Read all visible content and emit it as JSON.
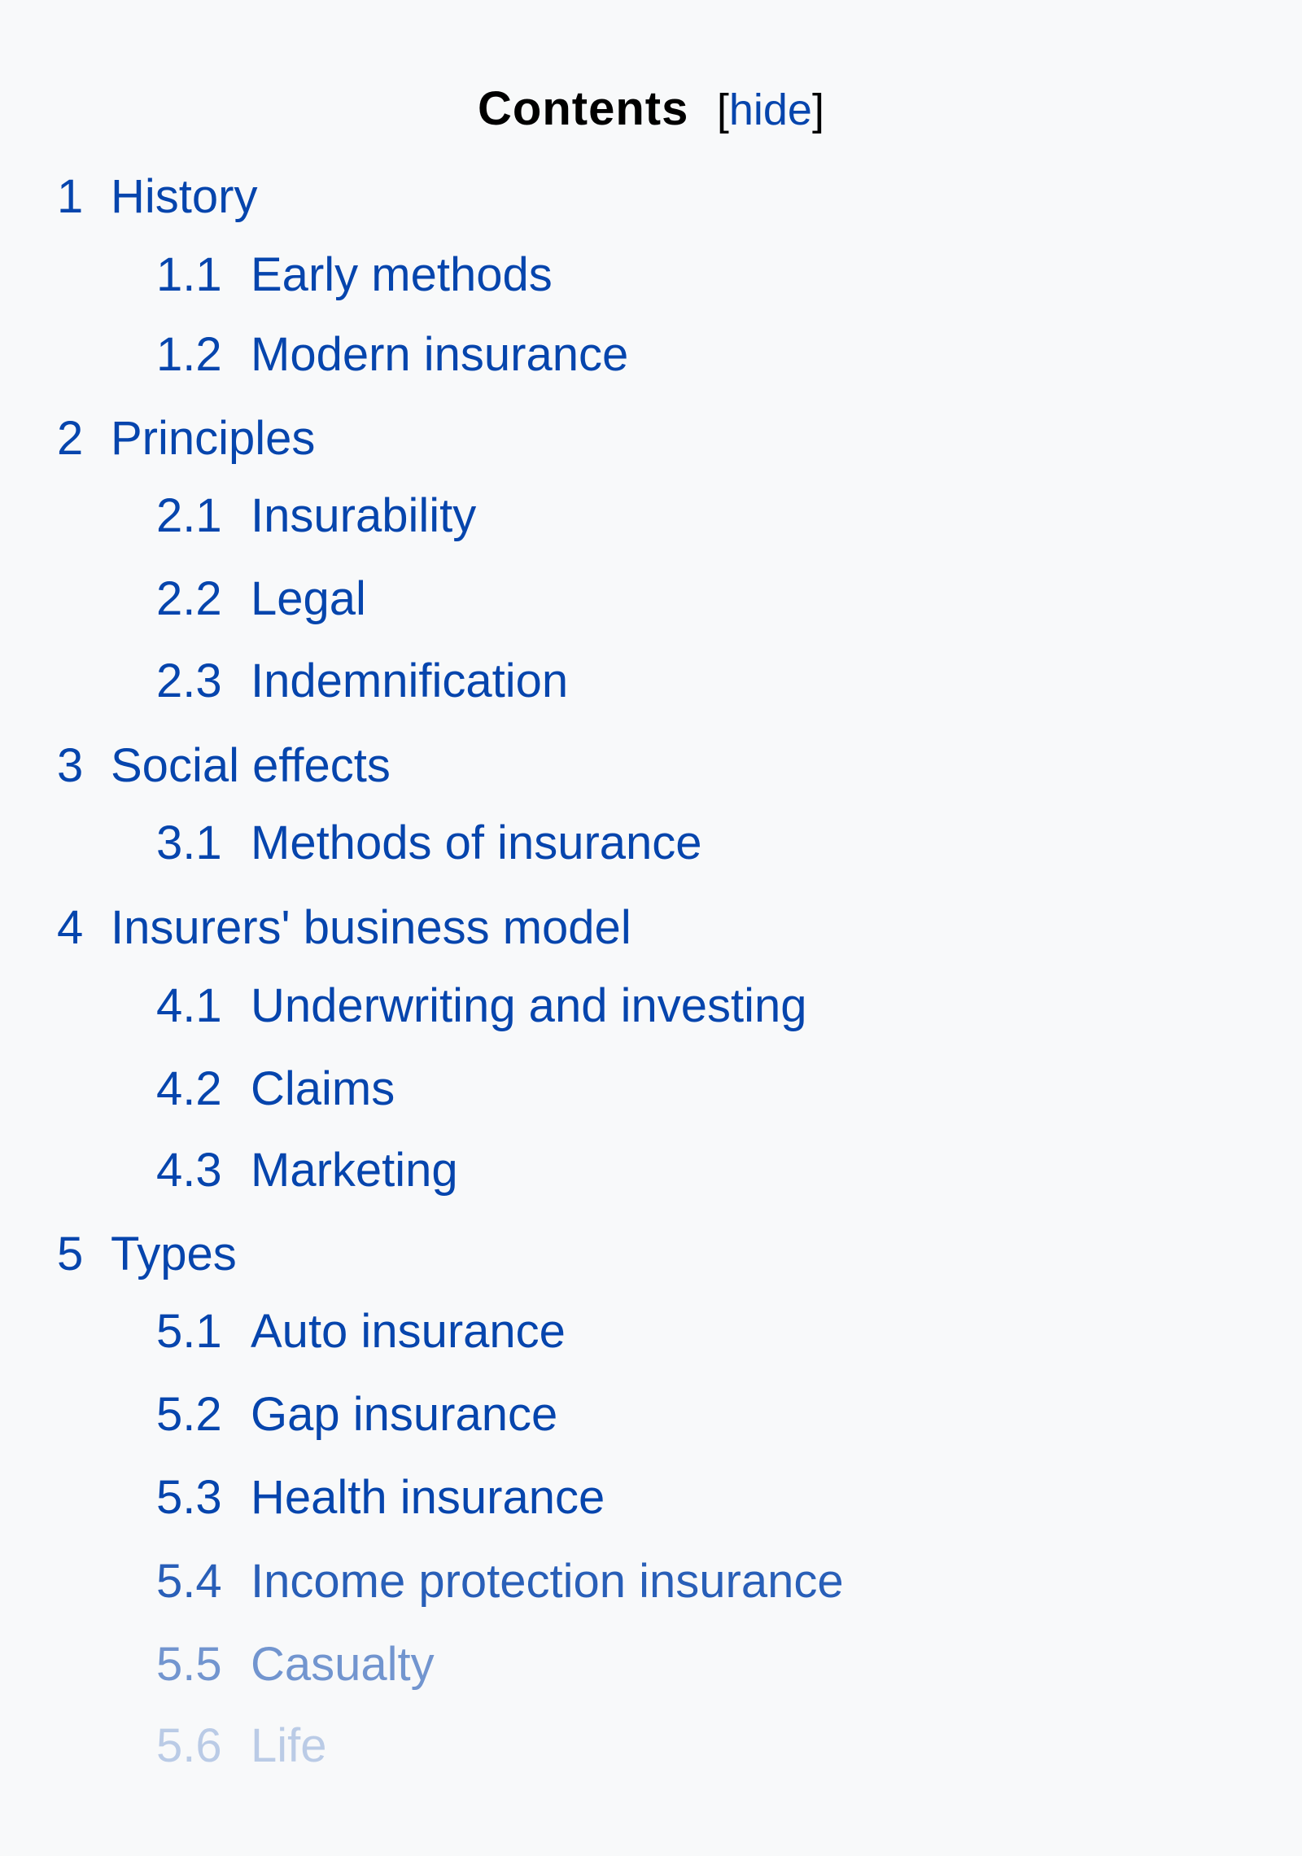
{
  "toc": {
    "title": "Contents",
    "toggle_open": "[",
    "toggle_label": "hide",
    "toggle_close": "]",
    "items": [
      {
        "number": "1",
        "label": "History",
        "level": 1
      },
      {
        "number": "1.1",
        "label": "Early methods",
        "level": 2
      },
      {
        "number": "1.2",
        "label": "Modern insurance",
        "level": 2
      },
      {
        "number": "2",
        "label": "Principles",
        "level": 1
      },
      {
        "number": "2.1",
        "label": "Insurability",
        "level": 2
      },
      {
        "number": "2.2",
        "label": "Legal",
        "level": 2
      },
      {
        "number": "2.3",
        "label": "Indemnification",
        "level": 2
      },
      {
        "number": "3",
        "label": "Social effects",
        "level": 1
      },
      {
        "number": "3.1",
        "label": "Methods of insurance",
        "level": 2
      },
      {
        "number": "4",
        "label": "Insurers' business model",
        "level": 1
      },
      {
        "number": "4.1",
        "label": "Underwriting and investing",
        "level": 2
      },
      {
        "number": "4.2",
        "label": "Claims",
        "level": 2
      },
      {
        "number": "4.3",
        "label": "Marketing",
        "level": 2
      },
      {
        "number": "5",
        "label": "Types",
        "level": 1
      },
      {
        "number": "5.1",
        "label": "Auto insurance",
        "level": 2
      },
      {
        "number": "5.2",
        "label": "Gap insurance",
        "level": 2
      },
      {
        "number": "5.3",
        "label": "Health insurance",
        "level": 2
      },
      {
        "number": "5.4",
        "label": "Income protection insurance",
        "level": 2
      },
      {
        "number": "5.5",
        "label": "Casualty",
        "level": 2
      },
      {
        "number": "5.6",
        "label": "Life",
        "level": 2
      }
    ]
  },
  "colors": {
    "link": "#0645ad",
    "background": "#f8f9fa"
  }
}
